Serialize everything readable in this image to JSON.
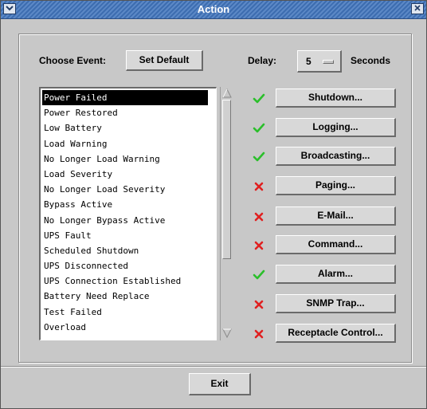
{
  "window": {
    "title": "Action"
  },
  "header": {
    "choose_event_label": "Choose Event:",
    "set_default_label": "Set Default",
    "delay_label": "Delay:",
    "delay_value": "5",
    "seconds_label": "Seconds"
  },
  "events": [
    "Power Failed",
    "Power Restored",
    "Low Battery",
    "Load Warning",
    "No Longer Load Warning",
    "Load Severity",
    "No Longer Load Severity",
    "Bypass Active",
    "No Longer Bypass Active",
    "UPS Fault",
    "Scheduled Shutdown",
    "UPS Disconnected",
    "UPS Connection Established",
    "Battery Need Replace",
    "Test Failed",
    "Overload"
  ],
  "selected_event": "Power Failed",
  "actions": [
    {
      "label": "Shutdown...",
      "enabled": true
    },
    {
      "label": "Logging...",
      "enabled": true
    },
    {
      "label": "Broadcasting...",
      "enabled": true
    },
    {
      "label": "Paging...",
      "enabled": false
    },
    {
      "label": "E-Mail...",
      "enabled": false
    },
    {
      "label": "Command...",
      "enabled": false
    },
    {
      "label": "Alarm...",
      "enabled": true
    },
    {
      "label": "SNMP Trap...",
      "enabled": false
    },
    {
      "label": "Receptacle Control...",
      "enabled": false
    }
  ],
  "footer": {
    "exit_label": "Exit"
  },
  "colors": {
    "check": "#2bbf2b",
    "cross": "#e02020",
    "titlebar": "#3d6db0"
  }
}
